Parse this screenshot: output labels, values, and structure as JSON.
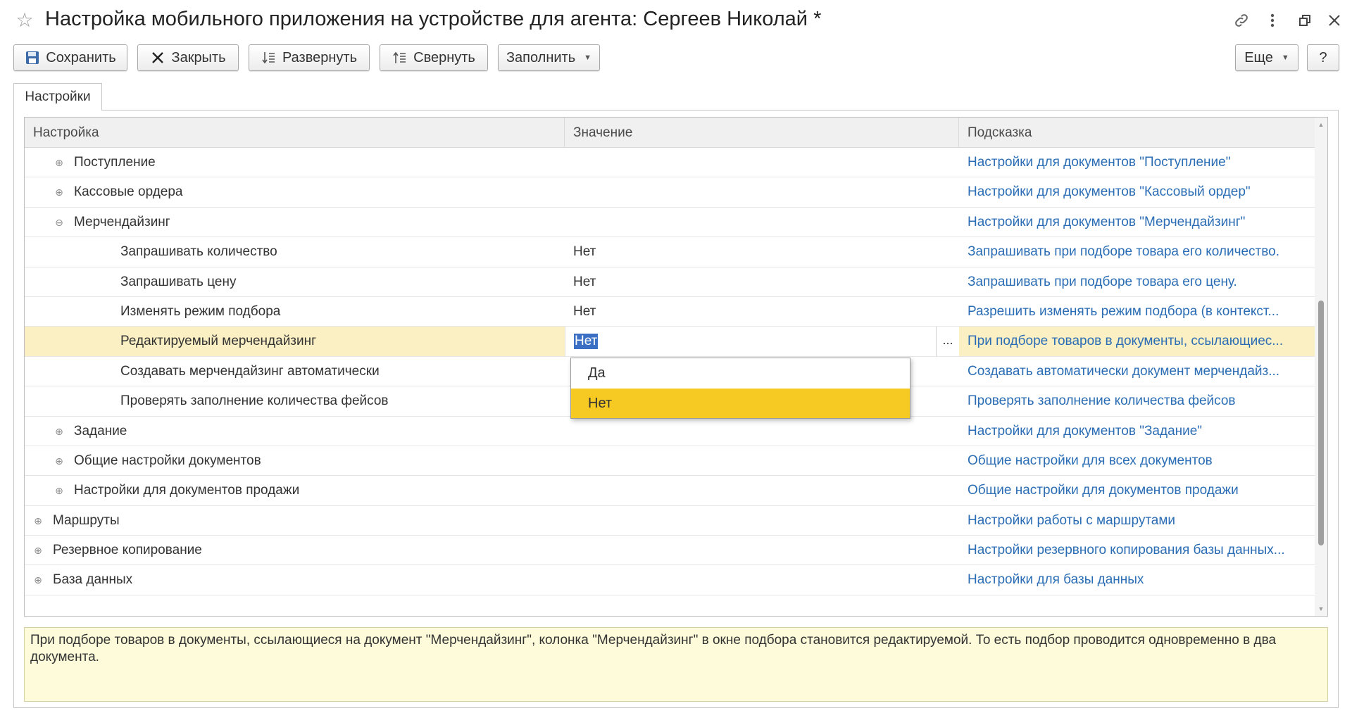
{
  "window": {
    "title": "Настройка мобильного приложения на устройстве для агента: Сергеев Николай *"
  },
  "toolbar": {
    "save_label": "Сохранить",
    "close_label": "Закрыть",
    "expand_label": "Развернуть",
    "collapse_label": "Свернуть",
    "fill_label": "Заполнить",
    "more_label": "Еще",
    "help_label": "?"
  },
  "tabs": [
    {
      "label": "Настройки"
    }
  ],
  "grid": {
    "columns": [
      "Настройка",
      "Значение",
      "Подсказка"
    ],
    "rows": [
      {
        "level": 1,
        "toggle": "plus",
        "name": "Поступление",
        "value": "",
        "hint": "Настройки для документов \"Поступление\""
      },
      {
        "level": 1,
        "toggle": "plus",
        "name": "Кассовые ордера",
        "value": "",
        "hint": "Настройки для документов \"Кассовый ордер\""
      },
      {
        "level": 1,
        "toggle": "minus",
        "name": "Мерчендайзинг",
        "value": "",
        "hint": "Настройки для документов \"Мерчендайзинг\""
      },
      {
        "level": 2,
        "toggle": "",
        "name": "Запрашивать количество",
        "value": "Нет",
        "hint": "Запрашивать при подборе товара его количество."
      },
      {
        "level": 2,
        "toggle": "",
        "name": "Запрашивать цену",
        "value": "Нет",
        "hint": "Запрашивать при подборе товара его цену."
      },
      {
        "level": 2,
        "toggle": "",
        "name": "Изменять режим подбора",
        "value": "Нет",
        "hint": "Разрешить изменять режим подбора (в контекст..."
      },
      {
        "level": 2,
        "toggle": "",
        "name": "Редактируемый мерчендайзинг",
        "value": "Нет",
        "hint": "При подборе товаров в документы, ссылающиес...",
        "selected": true,
        "editing": true
      },
      {
        "level": 2,
        "toggle": "",
        "name": "Создавать мерчендайзинг автоматически",
        "value": "",
        "hint": "Создавать автоматически документ мерчендайз..."
      },
      {
        "level": 2,
        "toggle": "",
        "name": "Проверять заполнение количества фейсов",
        "value": "",
        "hint": "Проверять заполнение количества фейсов"
      },
      {
        "level": 1,
        "toggle": "plus",
        "name": "Задание",
        "value": "",
        "hint": "Настройки для документов \"Задание\""
      },
      {
        "level": 1,
        "toggle": "plus",
        "name": "Общие настройки документов",
        "value": "",
        "hint": "Общие настройки для всех документов"
      },
      {
        "level": 1,
        "toggle": "plus",
        "name": "Настройки для документов продажи",
        "value": "",
        "hint": "Общие настройки для документов продажи"
      },
      {
        "level": 0,
        "toggle": "plus",
        "name": "Маршруты",
        "value": "",
        "hint": "Настройки работы с маршрутами"
      },
      {
        "level": 0,
        "toggle": "plus",
        "name": "Резервное копирование",
        "value": "",
        "hint": "Настройки резервного копирования базы данных..."
      },
      {
        "level": 0,
        "toggle": "plus",
        "name": "База данных",
        "value": "",
        "hint": "Настройки для базы данных"
      }
    ]
  },
  "dropdown": {
    "options": [
      "Да",
      "Нет"
    ],
    "selected": "Нет"
  },
  "hint_panel": {
    "text": "При подборе товаров в документы, ссылающиеся на документ \"Мерчендайзинг\", колонка \"Мерчендайзинг\" в окне подбора становится редактируемой. То есть подбор проводится одновременно в два документа."
  },
  "icons": {
    "favorite": "star-icon",
    "link": "link-icon",
    "menu": "more-vertical-icon",
    "restore": "restore-window-icon",
    "close": "close-icon"
  },
  "colors": {
    "selected_row": "#fbf0c4",
    "dropdown_active": "#f7c923",
    "hint_text": "#2b6db4",
    "hint_panel_bg": "#fdfbd9",
    "text_selection": "#3b6fc4"
  },
  "scroll": {
    "position_fraction": 0.36,
    "visible_fraction": 0.52
  }
}
